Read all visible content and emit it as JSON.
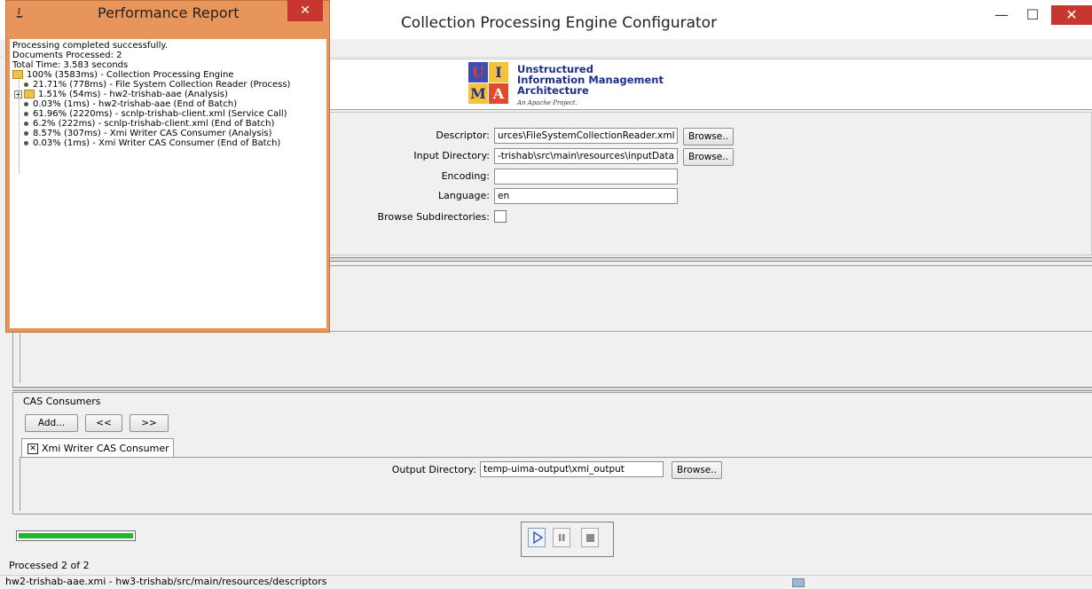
{
  "window": {
    "title": "Collection Processing Engine Configurator",
    "minimize_glyph": "—",
    "maximize_glyph": "☐",
    "close_glyph": "✕"
  },
  "banner": {
    "logo_cells": [
      "U",
      "I",
      "M",
      "A"
    ],
    "logo_lines": [
      "Unstructured",
      "Information Management",
      "Architecture"
    ],
    "logo_subtitle": "An Apache Project."
  },
  "reader": {
    "descriptor_label": "Descriptor:",
    "descriptor_value": "urces\\FileSystemCollectionReader.xml",
    "input_dir_label": "Input Directory:",
    "input_dir_value": "-trishab\\src\\main\\resources\\inputData",
    "encoding_label": "Encoding:",
    "encoding_value": "",
    "language_label": "Language:",
    "language_value": "en",
    "browse_subdirs_label": "Browse Subdirectories:",
    "browse_label": "Browse.."
  },
  "consumers": {
    "section_label": "CAS Consumers",
    "add_label": "Add...",
    "left_label": "<<",
    "right_label": ">>",
    "tab_label": "Xmi Writer CAS Consumer",
    "tab_close_glyph": "✕",
    "output_dir_label": "Output Directory:",
    "output_dir_value": "temp-uima-output\\xmi_output",
    "browse_label": "Browse.."
  },
  "progress": {
    "fraction": 1.0,
    "processed_text": "Processed 2 of 2"
  },
  "status_bar": {
    "text": "hw2-trishab-aae.xmi - hw3-trishab/src/main/resources/descriptors"
  },
  "performance_report": {
    "title": "Performance Report",
    "close_glyph": "✕",
    "status": "Processing completed successfully.",
    "documents": "Documents Processed: 2",
    "total_time": "Total Time: 3.583 seconds",
    "root": "100% (3583ms) - Collection Processing Engine",
    "items": [
      "21.71% (778ms) - File System Collection Reader (Process)",
      "1.51% (54ms) - hw2-trishab-aae (Analysis)",
      "0.03% (1ms) - hw2-trishab-aae (End of Batch)",
      "61.96% (2220ms) - scnlp-trishab-client.xml (Service Call)",
      "6.2% (222ms) - scnlp-trishab-client.xml (End of Batch)",
      "8.57% (307ms) - Xmi Writer CAS Consumer (Analysis)",
      "0.03% (1ms) - Xmi Writer CAS Consumer (End of Batch)"
    ]
  },
  "colors": {
    "accent_orange": "#e7955a",
    "close_red": "#c7372f",
    "progress_green": "#1fb72e",
    "logo_blue": "#1d2e8a"
  }
}
